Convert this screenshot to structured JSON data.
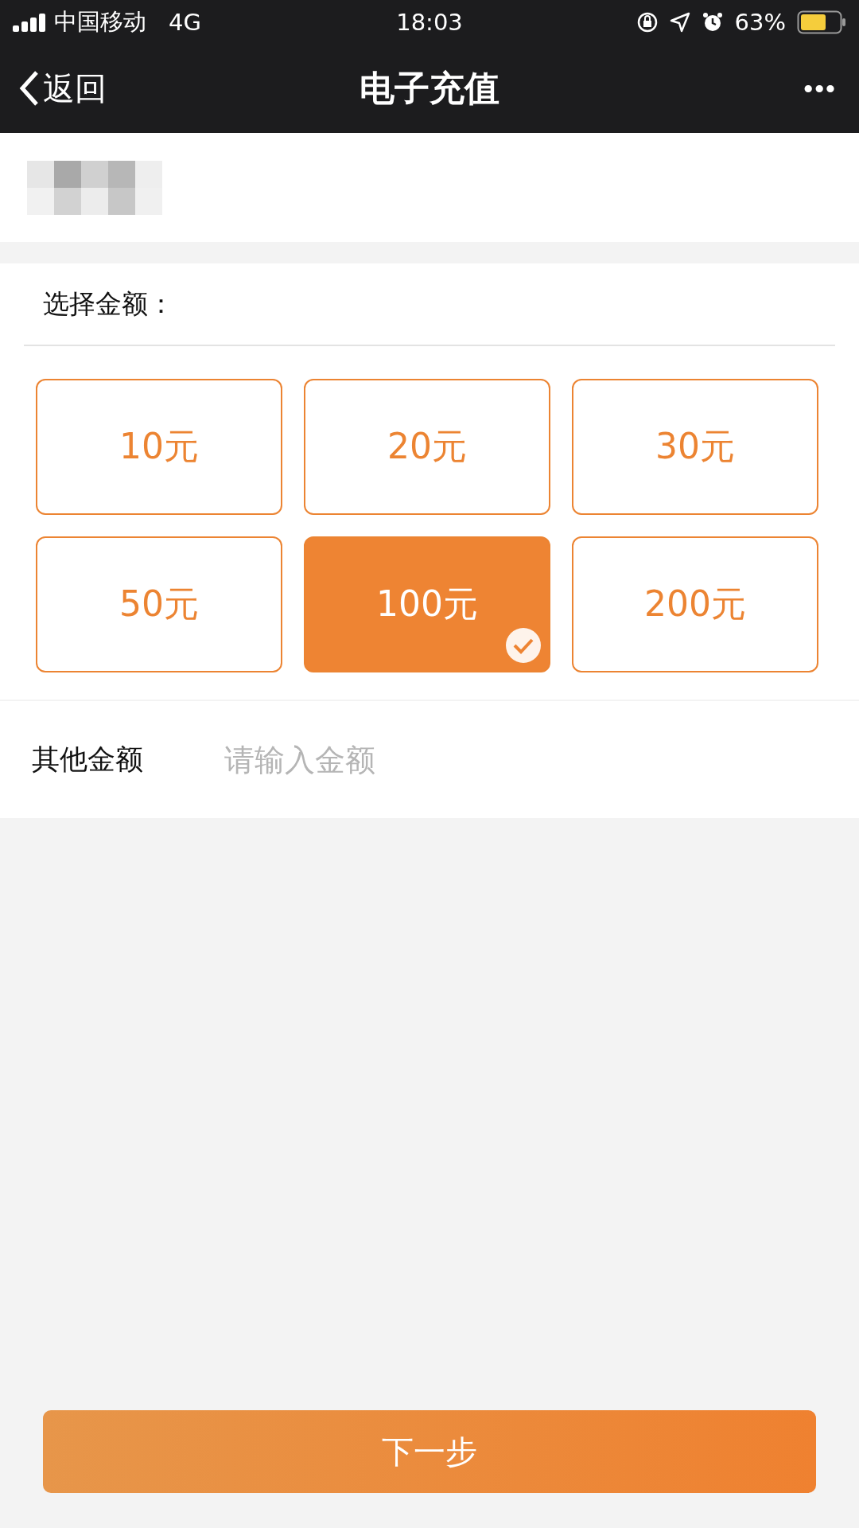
{
  "status_bar": {
    "carrier": "中国移动",
    "network": "4G",
    "time": "18:03",
    "battery": "63%"
  },
  "nav": {
    "back": "返回",
    "title": "电子充值",
    "more": "•••"
  },
  "amount_section": {
    "label": "选择金额：",
    "options": [
      {
        "label": "10元",
        "selected": false
      },
      {
        "label": "20元",
        "selected": false
      },
      {
        "label": "30元",
        "selected": false
      },
      {
        "label": "50元",
        "selected": false
      },
      {
        "label": "100元",
        "selected": true
      },
      {
        "label": "200元",
        "selected": false
      }
    ]
  },
  "other_amount": {
    "label": "其他金额",
    "placeholder": "请输入金额"
  },
  "next_button": "下一步"
}
